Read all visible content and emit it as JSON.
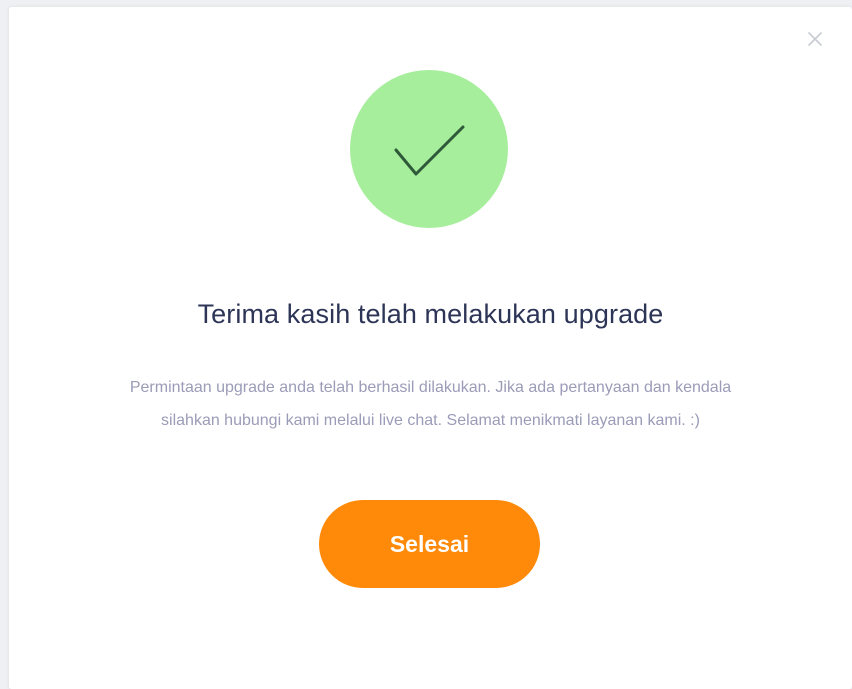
{
  "dialog": {
    "close_icon": "close-icon",
    "success_icon": "checkmark-icon",
    "title": "Terima kasih telah melakukan upgrade",
    "message_line1": "Permintaan upgrade anda telah berhasil dilakukan. Jika ada pertanyaan dan kendala",
    "message_line2": "silahkan hubungi kami melalui live chat. Selamat menikmati layanan kami. :)",
    "done_label": "Selesai"
  },
  "colors": {
    "success_circle": "#a6ee9c",
    "checkmark": "#2f5a3a",
    "title": "#2d3557",
    "message": "#9a9cb8",
    "button": "#ff8a0a",
    "close_icon": "#c9cbd3"
  }
}
